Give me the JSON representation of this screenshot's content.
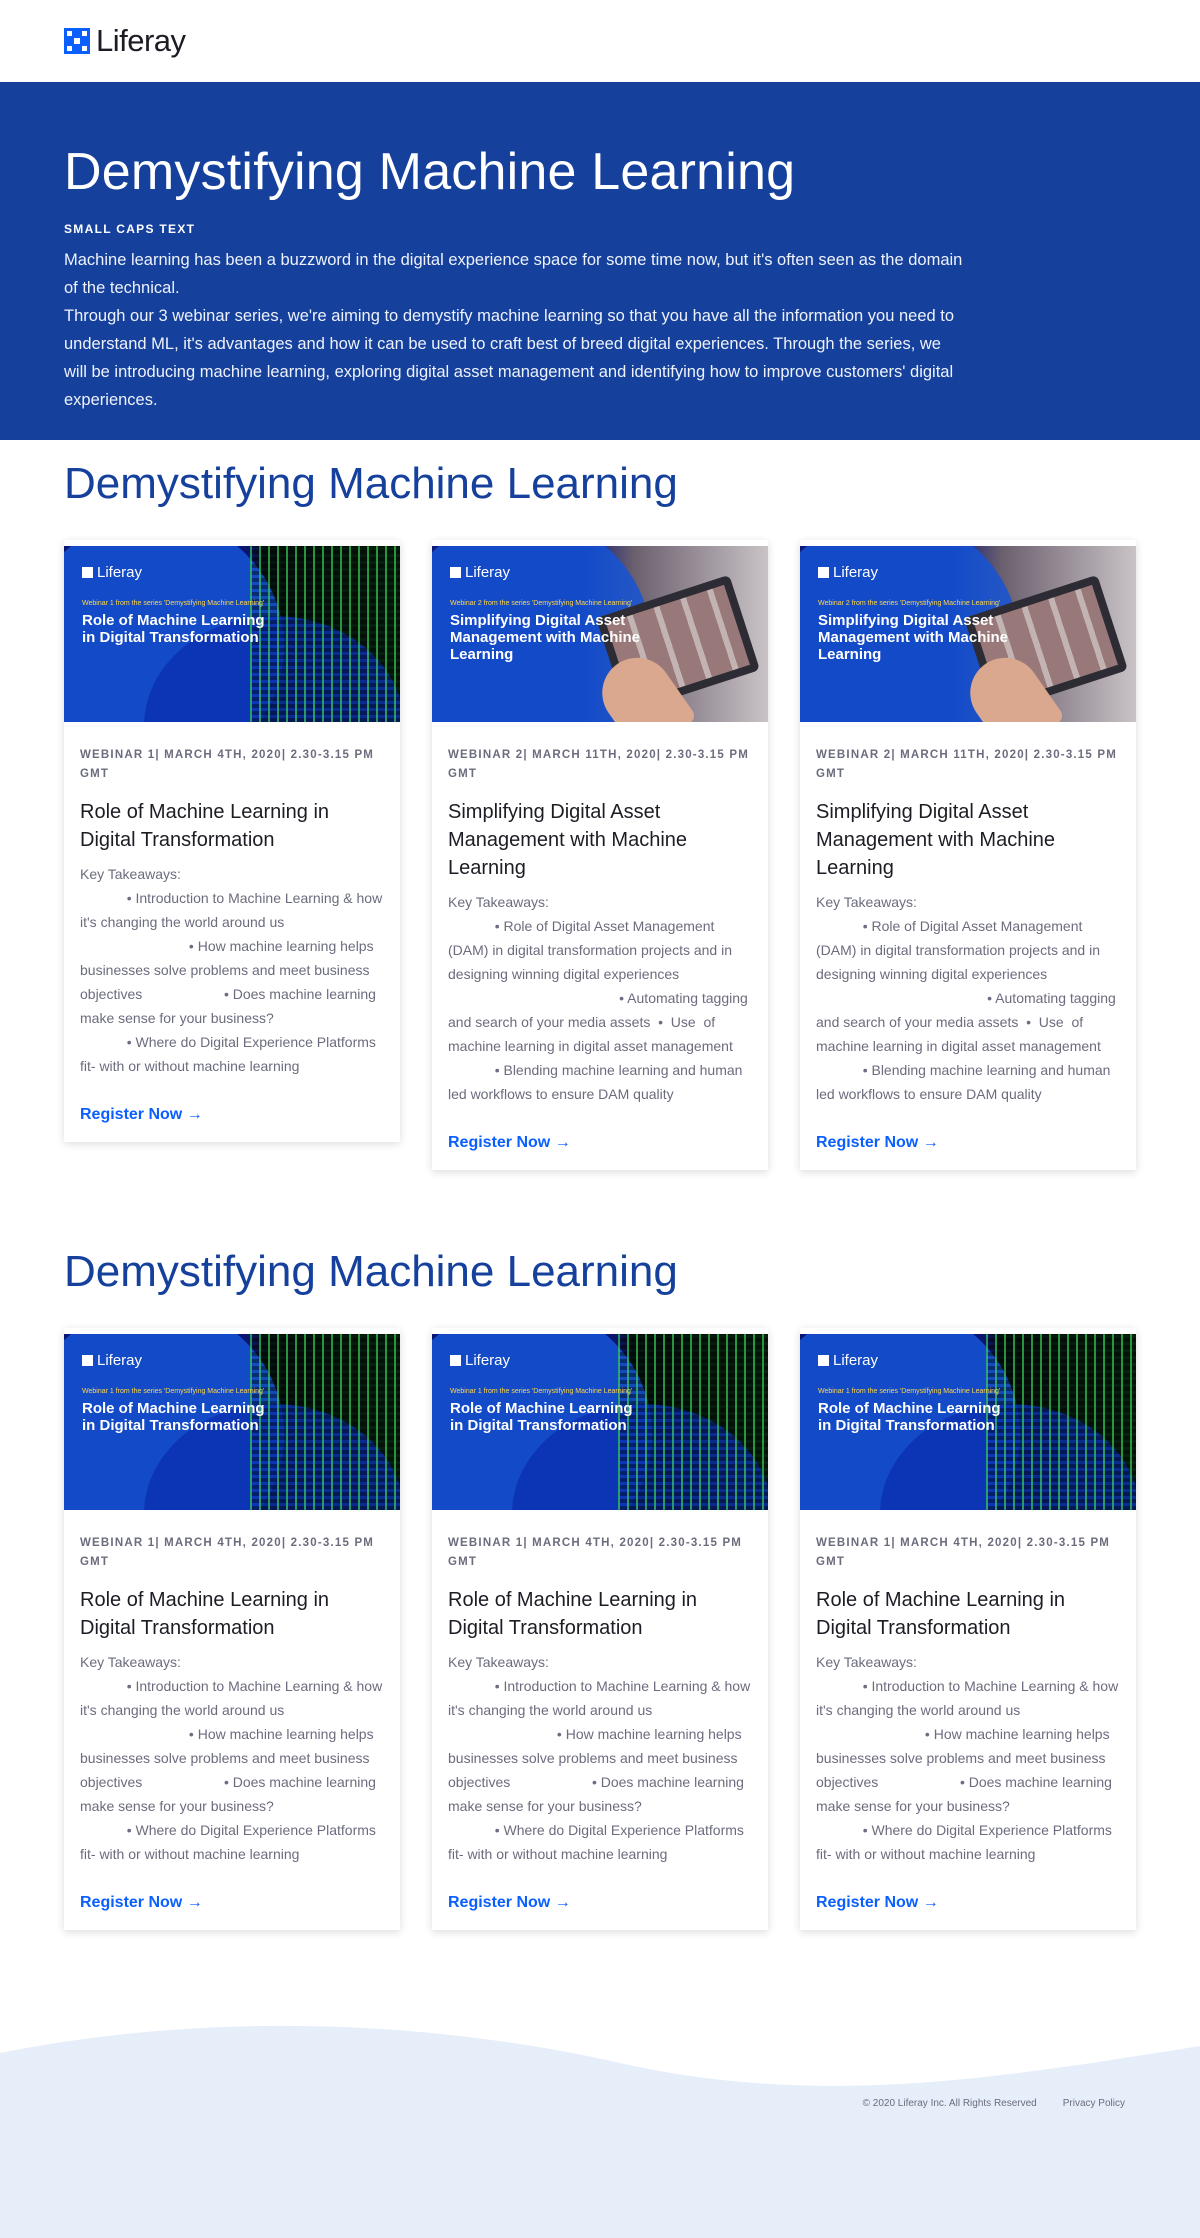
{
  "header": {
    "logo_text": "Liferay"
  },
  "hero": {
    "title": "Demystifying Machine Learning",
    "caps": "SMALL CAPS TEXT",
    "para1": "Machine learning has been a buzzword in the digital experience space for some time now, but it's often seen as the domain of the technical.",
    "para2": "Through our 3 webinar series, we're aiming to demystify machine learning so that you have all the information you need to understand ML, it's advantages and how it can be used to craft best of breed digital experiences.  Through the series, we will be introducing machine learning, exploring digital asset management and identifying how to improve customers' digital experiences."
  },
  "section1": {
    "title": "Demystifying Machine Learning",
    "cards": [
      {
        "thumb_brand": "Liferay",
        "thumb_series": "Webinar 1 from the series 'Demystifying Machine Learning'",
        "thumb_title": "Role of Machine Learning in Digital Transformation",
        "meta": "WEBINAR 1| MARCH 4TH, 2020| 2.30-3.15 PM GMT",
        "title": "Role of Machine Learning in Digital Transformation",
        "desc": "Key Takeaways:\n            • Introduction to Machine Learning & how it's changing the world around us\n                            • How machine learning helps businesses solve problems and meet business objectives                     • Does machine learning make sense for your business?\n            • Where do Digital Experience Platforms fit- with or without machine learning",
        "cta": "Register Now →"
      },
      {
        "thumb_brand": "Liferay",
        "thumb_series": "Webinar 2 from the series 'Demystifying Machine Learning'",
        "thumb_title": "Simplifying Digital Asset Management with Machine Learning",
        "meta": "WEBINAR 2| MARCH 11TH, 2020| 2.30-3.15 PM GMT",
        "title": "Simplifying  Digital Asset Management with Machine Learning",
        "desc": "Key Takeaways:\n            • Role of Digital Asset Management (DAM) in digital transformation projects and in designing winning digital experiences\n                                            • Automating tagging and search of your media assets  •  Use  of machine learning in digital asset management\n            • Blending machine learning and human led workflows to ensure DAM quality",
        "cta": "Register Now →"
      },
      {
        "thumb_brand": "Liferay",
        "thumb_series": "Webinar 2 from the series 'Demystifying Machine Learning'",
        "thumb_title": "Simplifying Digital Asset Management with Machine Learning",
        "meta": "WEBINAR 2| MARCH 11TH, 2020| 2.30-3.15 PM GMT",
        "title": "Simplifying  Digital Asset Management with Machine Learning",
        "desc": "Key Takeaways:\n            • Role of Digital Asset Management (DAM) in digital transformation projects and in designing winning digital experiences\n                                            • Automating tagging and search of your media assets  •  Use  of machine learning in digital asset management\n            • Blending machine learning and human led workflows to ensure DAM quality",
        "cta": "Register Now →"
      }
    ]
  },
  "section2": {
    "title": "Demystifying Machine Learning",
    "cards": [
      {
        "thumb_brand": "Liferay",
        "thumb_series": "Webinar 1 from the series 'Demystifying Machine Learning'",
        "thumb_title": "Role of Machine Learning in Digital Transformation",
        "meta": "WEBINAR 1| MARCH 4TH, 2020| 2.30-3.15 PM GMT",
        "title": "Role of Machine Learning in Digital Transformation",
        "desc": "Key Takeaways:\n            • Introduction to Machine Learning & how it's changing the world around us\n                            • How machine learning helps businesses solve problems and meet business objectives                     • Does machine learning make sense for your business?\n            • Where do Digital Experience Platforms fit- with or without machine learning",
        "cta": "Register Now →"
      },
      {
        "thumb_brand": "Liferay",
        "thumb_series": "Webinar 1 from the series 'Demystifying Machine Learning'",
        "thumb_title": "Role of Machine Learning in Digital Transformation",
        "meta": "WEBINAR 1| MARCH 4TH, 2020| 2.30-3.15 PM GMT",
        "title": "Role of Machine Learning in Digital Transformation",
        "desc": "Key Takeaways:\n            • Introduction to Machine Learning & how it's changing the world around us\n                            • How machine learning helps businesses solve problems and meet business objectives                     • Does machine learning make sense for your business?\n            • Where do Digital Experience Platforms fit- with or without machine learning",
        "cta": "Register Now →"
      },
      {
        "thumb_brand": "Liferay",
        "thumb_series": "Webinar 1 from the series 'Demystifying Machine Learning'",
        "thumb_title": "Role of Machine Learning in Digital Transformation",
        "meta": "WEBINAR 1| MARCH 4TH, 2020| 2.30-3.15 PM GMT",
        "title": "Role of Machine Learning in Digital Transformation",
        "desc": "Key Takeaways:\n            • Introduction to Machine Learning & how it's changing the world around us\n                            • How machine learning helps businesses solve problems and meet business objectives                     • Does machine learning make sense for your business?\n            • Where do Digital Experience Platforms fit- with or without machine learning",
        "cta": "Register Now →"
      }
    ]
  },
  "footer": {
    "copyright": "© 2020 Liferay Inc. All Rights Reserved",
    "privacy": "Privacy Policy"
  },
  "colors": {
    "brand": "#15409c",
    "link": "#0b5fff",
    "footer_wave": "#e6eefa"
  }
}
